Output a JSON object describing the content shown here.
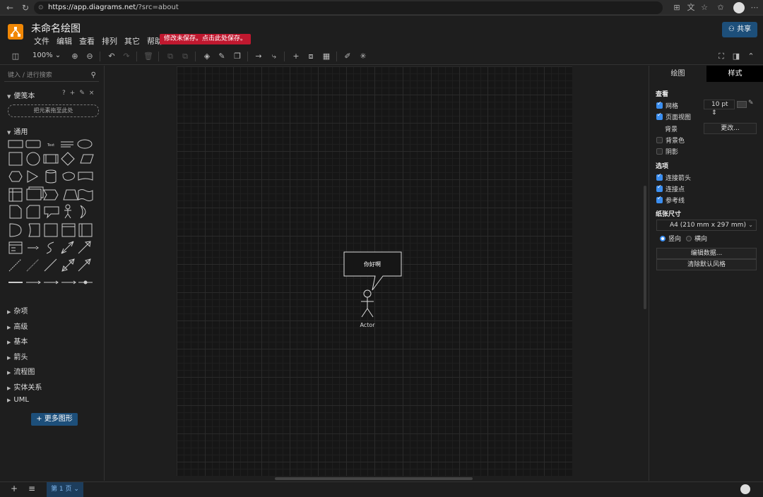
{
  "browser": {
    "url_host": "https://app.diagrams.net",
    "url_path": "/?src=about"
  },
  "header": {
    "title": "未命名绘图",
    "menu": [
      "文件",
      "编辑",
      "查看",
      "排列",
      "其它",
      "帮助"
    ],
    "unsaved_notice": "修改未保存。点击此处保存。",
    "share_label": "共享"
  },
  "toolbar": {
    "zoom": "100%"
  },
  "sidebar": {
    "search_placeholder": "键入 / 进行搜索",
    "scratchpad_label": "便笺本",
    "scratchpad_drop": "把元素拖至此处",
    "general_label": "通用",
    "sections": [
      "杂项",
      "高级",
      "基本",
      "箭头",
      "流程图",
      "实体关系",
      "UML"
    ],
    "more_shapes": "+ 更多图形"
  },
  "diagram": {
    "callout_text": "你好啊",
    "actor_label": "Actor"
  },
  "format_panel": {
    "tabs": [
      "绘图",
      "样式"
    ],
    "active_tab": "样式",
    "view_heading": "查看",
    "grid_label": "网格",
    "grid_size": "10 pt",
    "page_view_label": "页面视图",
    "background_label": "背景",
    "change_button": "更改...",
    "bg_color_label": "背景色",
    "shadow_label": "阴影",
    "options_heading": "选项",
    "connection_arrows": "连接箭头",
    "connection_points": "连接点",
    "guides": "参考线",
    "paper_heading": "纸张尺寸",
    "paper_size": "A4 (210 mm x 297 mm)",
    "portrait": "竖向",
    "landscape": "横向",
    "edit_data": "编辑数据...",
    "clear_style": "清除默认风格"
  },
  "bottom": {
    "page_tab": "第 1 页"
  },
  "colors": {
    "accent": "#3b8ef0",
    "logo": "#f08705",
    "unsaved": "#c0182f",
    "share": "#1d4f7a"
  }
}
